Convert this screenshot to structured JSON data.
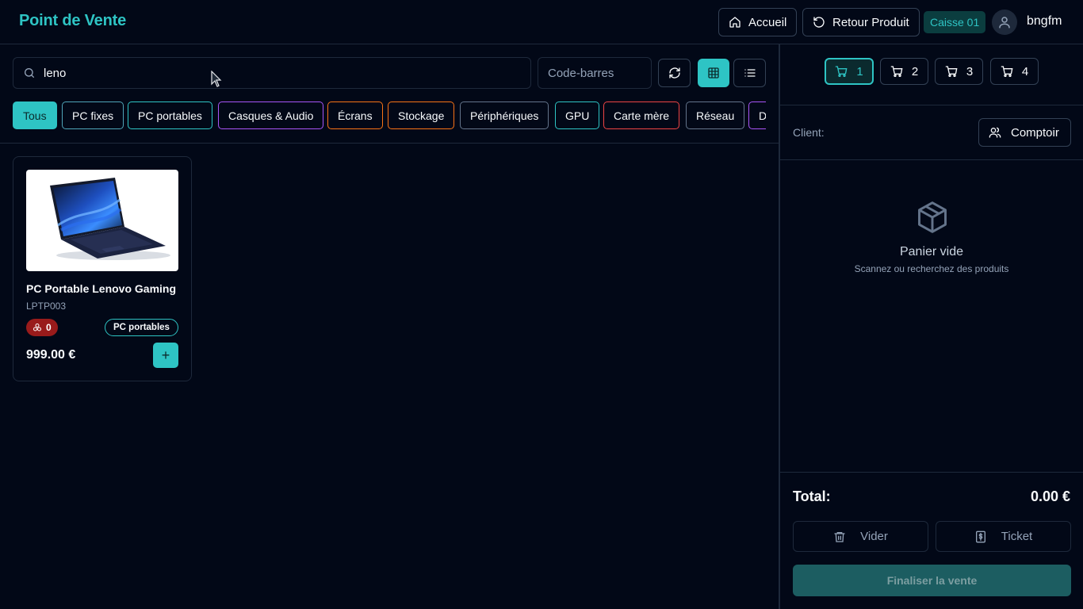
{
  "header": {
    "brand": "Point de Vente",
    "home_label": "Accueil",
    "return_label": "Retour Produit",
    "register_badge": "Caisse 01",
    "username": "bngfm"
  },
  "toolbar": {
    "search_value": "leno",
    "barcode_placeholder": "Code-barres"
  },
  "categories": [
    {
      "label": "Tous",
      "active": true,
      "color": "#2ec4c4"
    },
    {
      "label": "PC fixes",
      "color": "#4fa5b8"
    },
    {
      "label": "PC portables",
      "color": "#2ec4c4"
    },
    {
      "label": "Casques & Audio",
      "color": "#a855f7"
    },
    {
      "label": "Écrans",
      "color": "#f97316"
    },
    {
      "label": "Stockage",
      "color": "#f97316"
    },
    {
      "label": "Périphériques",
      "color": "#64748b"
    },
    {
      "label": "GPU",
      "color": "#2ec4c4"
    },
    {
      "label": "Carte mère",
      "color": "#ef4444"
    },
    {
      "label": "Réseau",
      "color": "#64748b"
    },
    {
      "label": "D",
      "color": "#a855f7"
    }
  ],
  "products": [
    {
      "name": "PC Portable Lenovo Gaming",
      "sku": "LPTP003",
      "stock": "0",
      "category": "PC portables",
      "price": "999.00 €",
      "add_label": "+"
    }
  ],
  "cart": {
    "tabs": [
      "1",
      "2",
      "3",
      "4"
    ],
    "active_tab": "1",
    "client_label": "Client:",
    "client_button": "Comptoir",
    "empty_title": "Panier vide",
    "empty_subtitle": "Scannez ou recherchez des produits",
    "total_label": "Total:",
    "total_value": "0.00 €",
    "clear_label": "Vider",
    "ticket_label": "Ticket",
    "finalize_label": "Finaliser la vente"
  },
  "colors": {
    "accent": "#2ec4c4",
    "background": "#020817",
    "border": "#1e293b",
    "stock_badge": "#991b1b"
  }
}
